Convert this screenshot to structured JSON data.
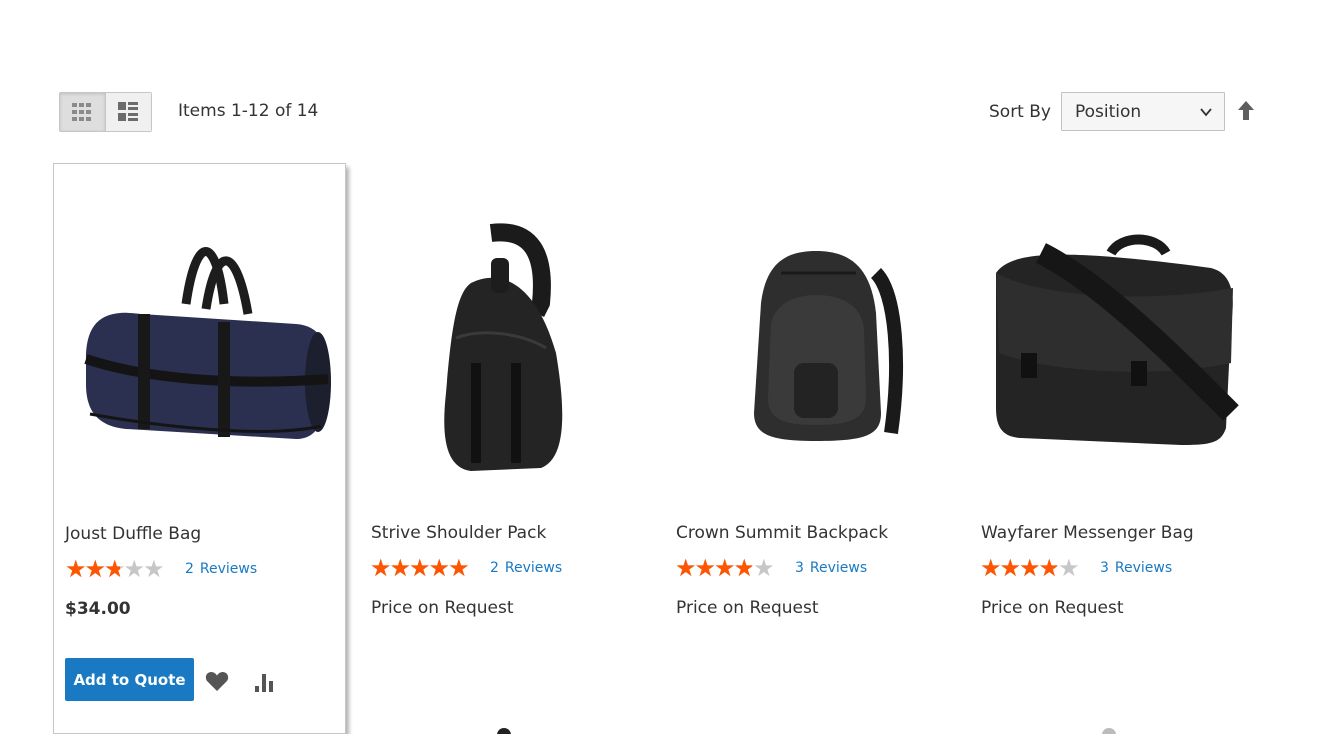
{
  "toolbar": {
    "view_modes": [
      {
        "name": "grid",
        "active": true,
        "icon": "grid-icon"
      },
      {
        "name": "list",
        "active": false,
        "icon": "list-icon"
      }
    ],
    "amount_text": "Items 1-12 of 14",
    "sort_label": "Sort By",
    "sort_selected": "Position",
    "sort_direction_icon": "arrow-up-icon"
  },
  "colors": {
    "accent": "#1979c3",
    "star": "#ff5501",
    "star_empty": "#c7c7c7",
    "text": "#333333"
  },
  "products": [
    {
      "name": "Joust Duffle Bag",
      "rating_fraction": 0.5,
      "review_count": "2",
      "review_label": "Reviews",
      "price": "$34.00",
      "add_label": "Add to Quote",
      "image": "duffle-bag",
      "active": true
    },
    {
      "name": "Strive Shoulder Pack",
      "rating_fraction": 0.9,
      "review_count": "2",
      "review_label": "Reviews",
      "price": "Price on Request",
      "image": "sling-pack"
    },
    {
      "name": "Crown Summit Backpack",
      "rating_fraction": 0.7,
      "review_count": "3",
      "review_label": "Reviews",
      "price": "Price on Request",
      "image": "backpack"
    },
    {
      "name": "Wayfarer Messenger Bag",
      "rating_fraction": 0.7,
      "review_count": "3",
      "review_label": "Reviews",
      "price": "Price on Request",
      "image": "messenger-bag"
    }
  ]
}
